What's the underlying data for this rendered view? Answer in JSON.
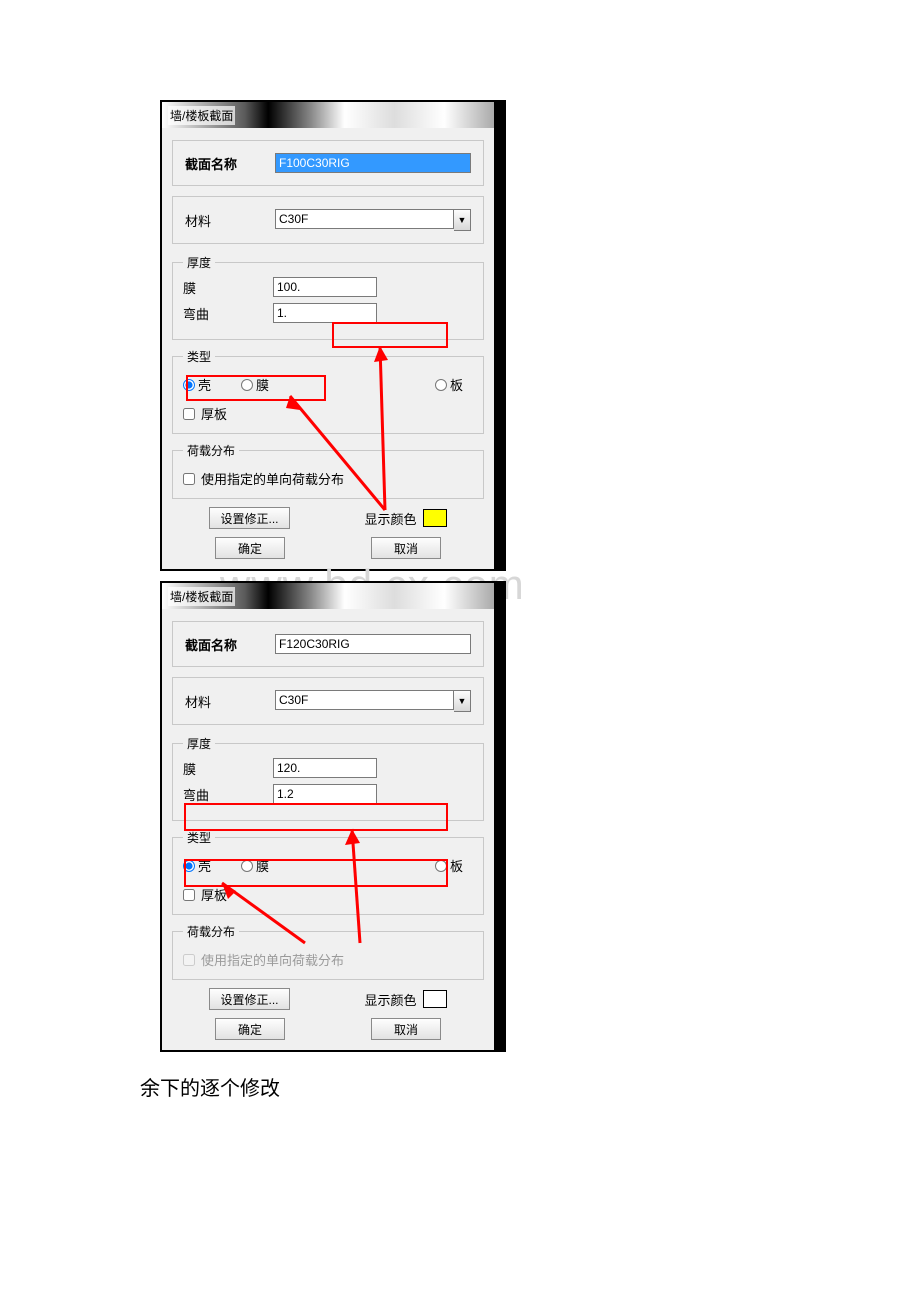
{
  "dialog1": {
    "title": "墙/楼板截面",
    "section_name_label": "截面名称",
    "section_name_value": "F100C30RIG",
    "material_label": "材料",
    "material_value": "C30F",
    "thickness_legend": "厚度",
    "membrane_label": "膜",
    "membrane_value": "100.",
    "bending_label": "弯曲",
    "bending_value": "1.",
    "type_legend": "类型",
    "type_shell": "壳",
    "type_membrane": "膜",
    "type_plate": "板",
    "thick_plate_label": "厚板",
    "load_legend": "荷载分布",
    "load_checkbox_label": "使用指定的单向荷载分布",
    "set_modifiers_btn": "设置修正...",
    "display_color_label": "显示颜色",
    "ok_btn": "确定",
    "cancel_btn": "取消"
  },
  "dialog2": {
    "title": "墙/楼板截面",
    "section_name_label": "截面名称",
    "section_name_value": "F120C30RIG",
    "material_label": "材料",
    "material_value": "C30F",
    "thickness_legend": "厚度",
    "membrane_label": "膜",
    "membrane_value": "120.",
    "bending_label": "弯曲",
    "bending_value": "1.2",
    "type_legend": "类型",
    "type_shell": "壳",
    "type_membrane": "膜",
    "type_plate": "板",
    "thick_plate_label": "厚板",
    "load_legend": "荷载分布",
    "load_checkbox_label": "使用指定的单向荷载分布",
    "set_modifiers_btn": "设置修正...",
    "display_color_label": "显示颜色",
    "ok_btn": "确定",
    "cancel_btn": "取消"
  },
  "footer_text": "余下的逐个修改",
  "watermark": "www.bd    cx.com"
}
